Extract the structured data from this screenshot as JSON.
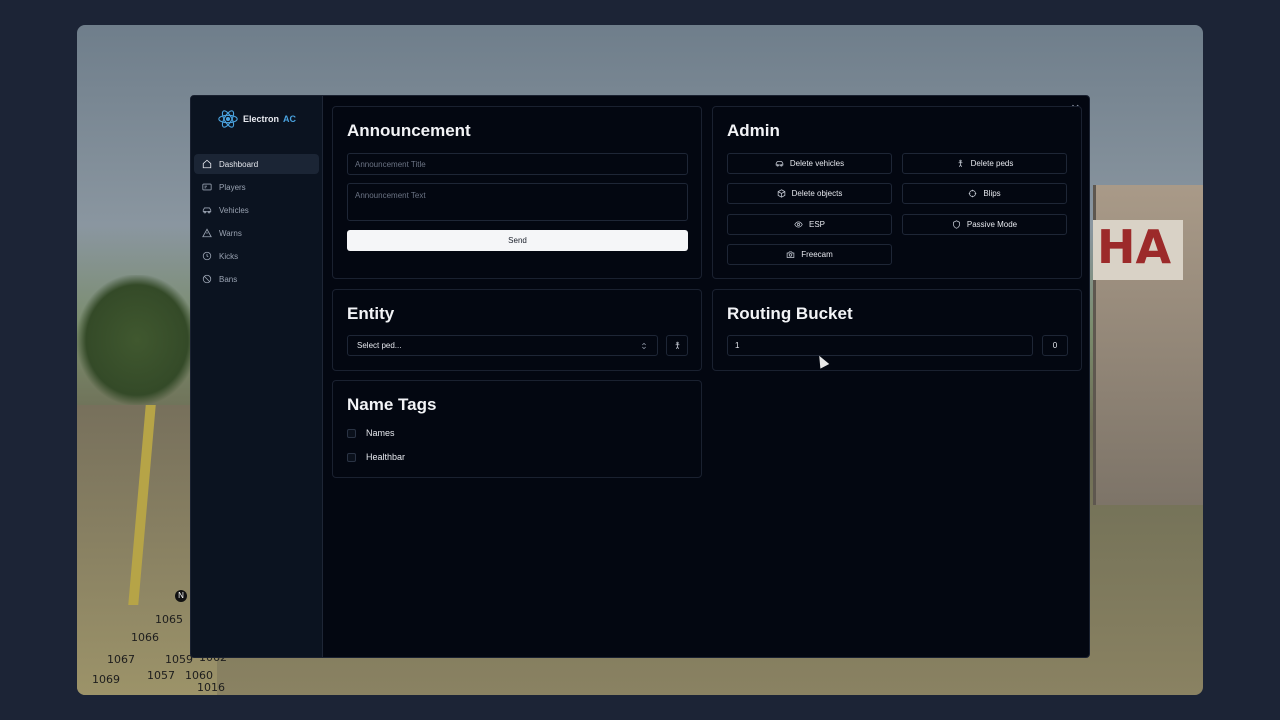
{
  "brand": {
    "name": "Electron",
    "accent": "AC",
    "accent_color": "#4aa3e0"
  },
  "sidebar": {
    "items": [
      {
        "label": "Dashboard",
        "icon": "home-icon",
        "active": true
      },
      {
        "label": "Players",
        "icon": "id-card-icon"
      },
      {
        "label": "Vehicles",
        "icon": "car-icon"
      },
      {
        "label": "Warns",
        "icon": "warning-icon"
      },
      {
        "label": "Kicks",
        "icon": "clock-icon"
      },
      {
        "label": "Bans",
        "icon": "ban-icon"
      }
    ]
  },
  "announcement": {
    "title": "Announcement",
    "title_placeholder": "Announcement Title",
    "text_placeholder": "Announcement Text",
    "send_label": "Send"
  },
  "admin": {
    "title": "Admin",
    "buttons": [
      {
        "label": "Delete vehicles",
        "icon": "car-icon"
      },
      {
        "label": "Delete peds",
        "icon": "person-icon"
      },
      {
        "label": "Delete objects",
        "icon": "box-icon"
      },
      {
        "label": "Blips",
        "icon": "crosshair-icon"
      },
      {
        "label": "ESP",
        "icon": "eye-icon"
      },
      {
        "label": "Passive Mode",
        "icon": "shield-icon"
      },
      {
        "label": "Freecam",
        "icon": "camera-icon"
      }
    ]
  },
  "entity": {
    "title": "Entity",
    "select_placeholder": "Select ped..."
  },
  "routing": {
    "title": "Routing Bucket",
    "value": "1",
    "current": "0"
  },
  "name_tags": {
    "title": "Name Tags",
    "options": [
      {
        "label": "Names"
      },
      {
        "label": "Healthbar"
      }
    ]
  },
  "background_map": {
    "labels": [
      "1065",
      "1066",
      "1067",
      "1059",
      "1062",
      "1057",
      "1060",
      "1069",
      "1016",
      "N"
    ]
  }
}
